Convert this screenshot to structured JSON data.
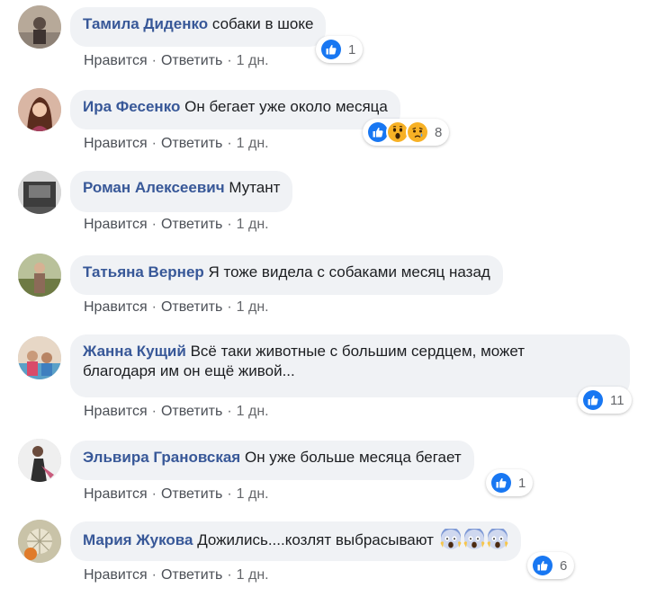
{
  "actions": {
    "like": "Нравится",
    "reply": "Ответить",
    "separator": "·"
  },
  "comments": [
    {
      "author": "Тамила Диденко",
      "text": "собаки в шоке",
      "time": "1 дн.",
      "reaction_count": "1"
    },
    {
      "author": "Ира Фесенко",
      "text": "Он бегает уже около месяца",
      "time": "1 дн.",
      "reaction_count": "8"
    },
    {
      "author": "Роман Алексеевич",
      "text": "Мутант",
      "time": "1 дн."
    },
    {
      "author": "Татьяна Вернер",
      "text": "Я тоже видела с собаками месяц назад",
      "time": "1 дн."
    },
    {
      "author": "Жанна Кущий",
      "text": "Всё таки животные с большим сердцем, может",
      "text2": "благодаря им он ещё живой...",
      "time": "1 дн.",
      "reaction_count": "11"
    },
    {
      "author": "Эльвира Грановская",
      "text": "Он уже больше месяца бегает",
      "time": "1 дн.",
      "reaction_count": "1"
    },
    {
      "author": "Мария Жукова",
      "text": "Дожились....козлят выбрасывают",
      "time": "1 дн.",
      "reaction_count": "6"
    }
  ],
  "colors": {
    "author": "#385898",
    "bubble": "#f0f2f5",
    "like_blue": "#1877f2",
    "meta": "#65676b"
  },
  "icons": {
    "like": "thumbs-up-icon",
    "wow": "wow-face-icon",
    "sad": "sad-face-icon",
    "scream": "scream-emoji-icon"
  }
}
